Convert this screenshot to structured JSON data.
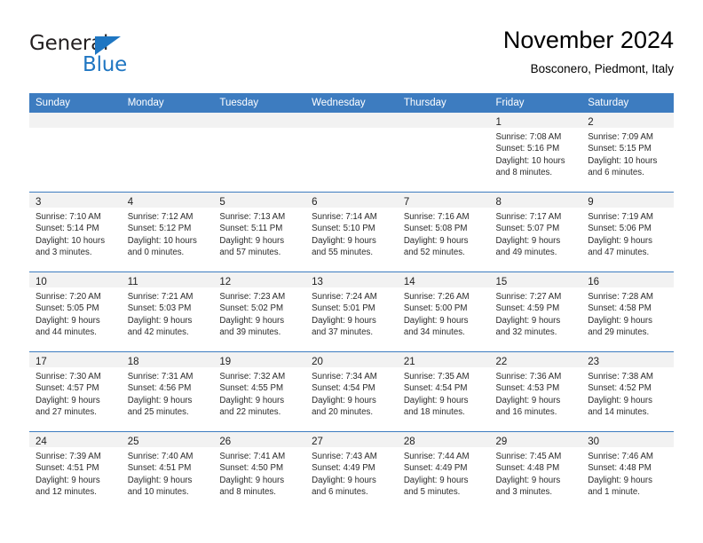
{
  "brand": {
    "name_top": "General",
    "name_bottom": "Blue",
    "triangle_icon": "triangle-icon",
    "color_blue": "#1f76c2",
    "color_dark": "#231f20"
  },
  "header": {
    "title": "November 2024",
    "subtitle": "Bosconero, Piedmont, Italy"
  },
  "theme": {
    "header_row_bg": "#3d7cc0",
    "header_row_text": "#ffffff",
    "daynum_strip_bg": "#f2f2f2",
    "cell_border": "#3d7cc0"
  },
  "weekday_headers": [
    "Sunday",
    "Monday",
    "Tuesday",
    "Wednesday",
    "Thursday",
    "Friday",
    "Saturday"
  ],
  "weeks": [
    [
      {
        "day": "",
        "lines": []
      },
      {
        "day": "",
        "lines": []
      },
      {
        "day": "",
        "lines": []
      },
      {
        "day": "",
        "lines": []
      },
      {
        "day": "",
        "lines": []
      },
      {
        "day": "1",
        "lines": [
          "Sunrise: 7:08 AM",
          "Sunset: 5:16 PM",
          "Daylight: 10 hours",
          "and 8 minutes."
        ]
      },
      {
        "day": "2",
        "lines": [
          "Sunrise: 7:09 AM",
          "Sunset: 5:15 PM",
          "Daylight: 10 hours",
          "and 6 minutes."
        ]
      }
    ],
    [
      {
        "day": "3",
        "lines": [
          "Sunrise: 7:10 AM",
          "Sunset: 5:14 PM",
          "Daylight: 10 hours",
          "and 3 minutes."
        ]
      },
      {
        "day": "4",
        "lines": [
          "Sunrise: 7:12 AM",
          "Sunset: 5:12 PM",
          "Daylight: 10 hours",
          "and 0 minutes."
        ]
      },
      {
        "day": "5",
        "lines": [
          "Sunrise: 7:13 AM",
          "Sunset: 5:11 PM",
          "Daylight: 9 hours",
          "and 57 minutes."
        ]
      },
      {
        "day": "6",
        "lines": [
          "Sunrise: 7:14 AM",
          "Sunset: 5:10 PM",
          "Daylight: 9 hours",
          "and 55 minutes."
        ]
      },
      {
        "day": "7",
        "lines": [
          "Sunrise: 7:16 AM",
          "Sunset: 5:08 PM",
          "Daylight: 9 hours",
          "and 52 minutes."
        ]
      },
      {
        "day": "8",
        "lines": [
          "Sunrise: 7:17 AM",
          "Sunset: 5:07 PM",
          "Daylight: 9 hours",
          "and 49 minutes."
        ]
      },
      {
        "day": "9",
        "lines": [
          "Sunrise: 7:19 AM",
          "Sunset: 5:06 PM",
          "Daylight: 9 hours",
          "and 47 minutes."
        ]
      }
    ],
    [
      {
        "day": "10",
        "lines": [
          "Sunrise: 7:20 AM",
          "Sunset: 5:05 PM",
          "Daylight: 9 hours",
          "and 44 minutes."
        ]
      },
      {
        "day": "11",
        "lines": [
          "Sunrise: 7:21 AM",
          "Sunset: 5:03 PM",
          "Daylight: 9 hours",
          "and 42 minutes."
        ]
      },
      {
        "day": "12",
        "lines": [
          "Sunrise: 7:23 AM",
          "Sunset: 5:02 PM",
          "Daylight: 9 hours",
          "and 39 minutes."
        ]
      },
      {
        "day": "13",
        "lines": [
          "Sunrise: 7:24 AM",
          "Sunset: 5:01 PM",
          "Daylight: 9 hours",
          "and 37 minutes."
        ]
      },
      {
        "day": "14",
        "lines": [
          "Sunrise: 7:26 AM",
          "Sunset: 5:00 PM",
          "Daylight: 9 hours",
          "and 34 minutes."
        ]
      },
      {
        "day": "15",
        "lines": [
          "Sunrise: 7:27 AM",
          "Sunset: 4:59 PM",
          "Daylight: 9 hours",
          "and 32 minutes."
        ]
      },
      {
        "day": "16",
        "lines": [
          "Sunrise: 7:28 AM",
          "Sunset: 4:58 PM",
          "Daylight: 9 hours",
          "and 29 minutes."
        ]
      }
    ],
    [
      {
        "day": "17",
        "lines": [
          "Sunrise: 7:30 AM",
          "Sunset: 4:57 PM",
          "Daylight: 9 hours",
          "and 27 minutes."
        ]
      },
      {
        "day": "18",
        "lines": [
          "Sunrise: 7:31 AM",
          "Sunset: 4:56 PM",
          "Daylight: 9 hours",
          "and 25 minutes."
        ]
      },
      {
        "day": "19",
        "lines": [
          "Sunrise: 7:32 AM",
          "Sunset: 4:55 PM",
          "Daylight: 9 hours",
          "and 22 minutes."
        ]
      },
      {
        "day": "20",
        "lines": [
          "Sunrise: 7:34 AM",
          "Sunset: 4:54 PM",
          "Daylight: 9 hours",
          "and 20 minutes."
        ]
      },
      {
        "day": "21",
        "lines": [
          "Sunrise: 7:35 AM",
          "Sunset: 4:54 PM",
          "Daylight: 9 hours",
          "and 18 minutes."
        ]
      },
      {
        "day": "22",
        "lines": [
          "Sunrise: 7:36 AM",
          "Sunset: 4:53 PM",
          "Daylight: 9 hours",
          "and 16 minutes."
        ]
      },
      {
        "day": "23",
        "lines": [
          "Sunrise: 7:38 AM",
          "Sunset: 4:52 PM",
          "Daylight: 9 hours",
          "and 14 minutes."
        ]
      }
    ],
    [
      {
        "day": "24",
        "lines": [
          "Sunrise: 7:39 AM",
          "Sunset: 4:51 PM",
          "Daylight: 9 hours",
          "and 12 minutes."
        ]
      },
      {
        "day": "25",
        "lines": [
          "Sunrise: 7:40 AM",
          "Sunset: 4:51 PM",
          "Daylight: 9 hours",
          "and 10 minutes."
        ]
      },
      {
        "day": "26",
        "lines": [
          "Sunrise: 7:41 AM",
          "Sunset: 4:50 PM",
          "Daylight: 9 hours",
          "and 8 minutes."
        ]
      },
      {
        "day": "27",
        "lines": [
          "Sunrise: 7:43 AM",
          "Sunset: 4:49 PM",
          "Daylight: 9 hours",
          "and 6 minutes."
        ]
      },
      {
        "day": "28",
        "lines": [
          "Sunrise: 7:44 AM",
          "Sunset: 4:49 PM",
          "Daylight: 9 hours",
          "and 5 minutes."
        ]
      },
      {
        "day": "29",
        "lines": [
          "Sunrise: 7:45 AM",
          "Sunset: 4:48 PM",
          "Daylight: 9 hours",
          "and 3 minutes."
        ]
      },
      {
        "day": "30",
        "lines": [
          "Sunrise: 7:46 AM",
          "Sunset: 4:48 PM",
          "Daylight: 9 hours",
          "and 1 minute."
        ]
      }
    ]
  ]
}
